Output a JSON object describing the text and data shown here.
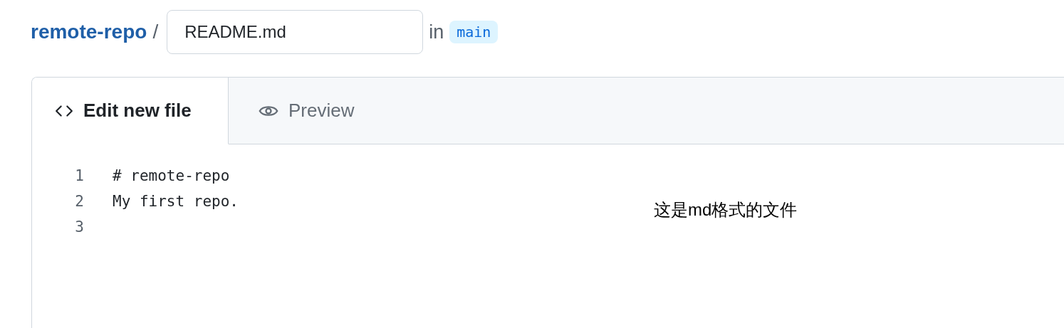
{
  "breadcrumb": {
    "repo": "remote-repo",
    "separator": "/",
    "filename": "README.md",
    "in_label": "in",
    "branch": "main"
  },
  "tabs": [
    {
      "label": "Edit new file",
      "kind": "code",
      "selected": true
    },
    {
      "label": "Preview",
      "kind": "eye",
      "selected": false
    }
  ],
  "editor": {
    "lines": [
      {
        "number": "1",
        "text": "# remote-repo"
      },
      {
        "number": "2",
        "text": "My first repo."
      },
      {
        "number": "3"
      }
    ]
  },
  "annotation": "这是md格式的文件"
}
